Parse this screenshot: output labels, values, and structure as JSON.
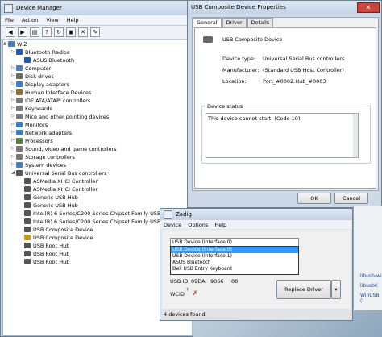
{
  "device_manager": {
    "title": "Device Manager",
    "menu": [
      "File",
      "Action",
      "View",
      "Help"
    ],
    "tree": [
      {
        "label": "WIZ",
        "level": 0,
        "exp": "▲",
        "icon": "computer",
        "color": "#4a7fbf"
      },
      {
        "label": "Bluetooth Radios",
        "level": 1,
        "exp": "▷",
        "icon": "bluetooth",
        "color": "#1f58c4"
      },
      {
        "label": "ASUS Bluetooth",
        "level": 2,
        "exp": "",
        "icon": "bluetooth",
        "color": "#1f58c4"
      },
      {
        "label": "Computer",
        "level": 1,
        "exp": "▷",
        "icon": "computer",
        "color": "#4a7fbf"
      },
      {
        "label": "Disk drives",
        "level": 1,
        "exp": "▷",
        "icon": "disk",
        "color": "#6b6b6b"
      },
      {
        "label": "Display adapters",
        "level": 1,
        "exp": "▷",
        "icon": "display",
        "color": "#3b7dc4"
      },
      {
        "label": "Human Interface Devices",
        "level": 1,
        "exp": "▷",
        "icon": "hid",
        "color": "#8a6f3a"
      },
      {
        "label": "IDE ATA/ATAPI controllers",
        "level": 1,
        "exp": "▷",
        "icon": "ide",
        "color": "#7a7a7a"
      },
      {
        "label": "Keyboards",
        "level": 1,
        "exp": "▷",
        "icon": "keyboard",
        "color": "#7a7a7a"
      },
      {
        "label": "Mice and other pointing devices",
        "level": 1,
        "exp": "▷",
        "icon": "mouse",
        "color": "#7a7a7a"
      },
      {
        "label": "Monitors",
        "level": 1,
        "exp": "▷",
        "icon": "monitor",
        "color": "#3b7dc4"
      },
      {
        "label": "Network adapters",
        "level": 1,
        "exp": "▷",
        "icon": "network",
        "color": "#3b7dc4"
      },
      {
        "label": "Processors",
        "level": 1,
        "exp": "▷",
        "icon": "chip",
        "color": "#5d7a4a"
      },
      {
        "label": "Sound, video and game controllers",
        "level": 1,
        "exp": "▷",
        "icon": "sound",
        "color": "#7a7a7a"
      },
      {
        "label": "Storage controllers",
        "level": 1,
        "exp": "▷",
        "icon": "storage",
        "color": "#7a7a7a"
      },
      {
        "label": "System devices",
        "level": 1,
        "exp": "▷",
        "icon": "system",
        "color": "#4a7fbf"
      },
      {
        "label": "Universal Serial Bus controllers",
        "level": 1,
        "exp": "◢",
        "icon": "usb",
        "color": "#555555"
      },
      {
        "label": "ASMedia XHCI Controller",
        "level": 2,
        "exp": "",
        "icon": "usb",
        "color": "#555555"
      },
      {
        "label": "ASMedia XHCI Controller",
        "level": 2,
        "exp": "",
        "icon": "usb",
        "color": "#555555"
      },
      {
        "label": "Generic USB Hub",
        "level": 2,
        "exp": "",
        "icon": "usb",
        "color": "#555555"
      },
      {
        "label": "Generic USB Hub",
        "level": 2,
        "exp": "",
        "icon": "usb",
        "color": "#555555"
      },
      {
        "label": "Intel(R) 6 Series/C200 Series Chipset Family USB",
        "level": 2,
        "exp": "",
        "icon": "usb",
        "color": "#555555"
      },
      {
        "label": "Intel(R) 6 Series/C200 Series Chipset Family USB",
        "level": 2,
        "exp": "",
        "icon": "usb",
        "color": "#555555"
      },
      {
        "label": "USB Composite Device",
        "level": 2,
        "exp": "",
        "icon": "usb",
        "color": "#555555"
      },
      {
        "label": "USB Composite Device",
        "level": 2,
        "exp": "",
        "icon": "usb-warning",
        "color": "#c9a000"
      },
      {
        "label": "USB Root Hub",
        "level": 2,
        "exp": "",
        "icon": "usb",
        "color": "#555555"
      },
      {
        "label": "USB Root Hub",
        "level": 2,
        "exp": "",
        "icon": "usb",
        "color": "#555555"
      },
      {
        "label": "USB Root Hub",
        "level": 2,
        "exp": "",
        "icon": "usb",
        "color": "#555555"
      }
    ]
  },
  "properties": {
    "title": "USB Composite Device Properties",
    "tabs": [
      "General",
      "Driver",
      "Details"
    ],
    "device_name": "USB Composite Device",
    "fields": [
      {
        "label": "Device type:",
        "value": "Universal Serial Bus controllers"
      },
      {
        "label": "Manufacturer:",
        "value": "(Standard USB Host Controller)"
      },
      {
        "label": "Location:",
        "value": "Port_#0002.Hub_#0003"
      }
    ],
    "status_label": "Device status",
    "status_text": "This device cannot start. (Code 10)",
    "ok": "OK",
    "cancel": "Cancel"
  },
  "zadig": {
    "title": "Zadig",
    "menu": [
      "Device",
      "Options",
      "Help"
    ],
    "selected": "USB Device (Interface 0)",
    "options": [
      "USB Device (Interface 0)",
      "USB Device (Interface 1)",
      "ASUS Bluetooth",
      "Dell USB Entry Keyboard"
    ],
    "usb_id_label": "USB ID",
    "usb_id": [
      "09DA",
      "9066",
      "00"
    ],
    "wcid_label": "WCID",
    "wcid_sup": "?",
    "replace": "Replace Driver",
    "status": "4 devices found."
  },
  "strip": {
    "links": [
      "libusb-wi",
      "libusbK",
      "WinUSB (l"
    ]
  }
}
